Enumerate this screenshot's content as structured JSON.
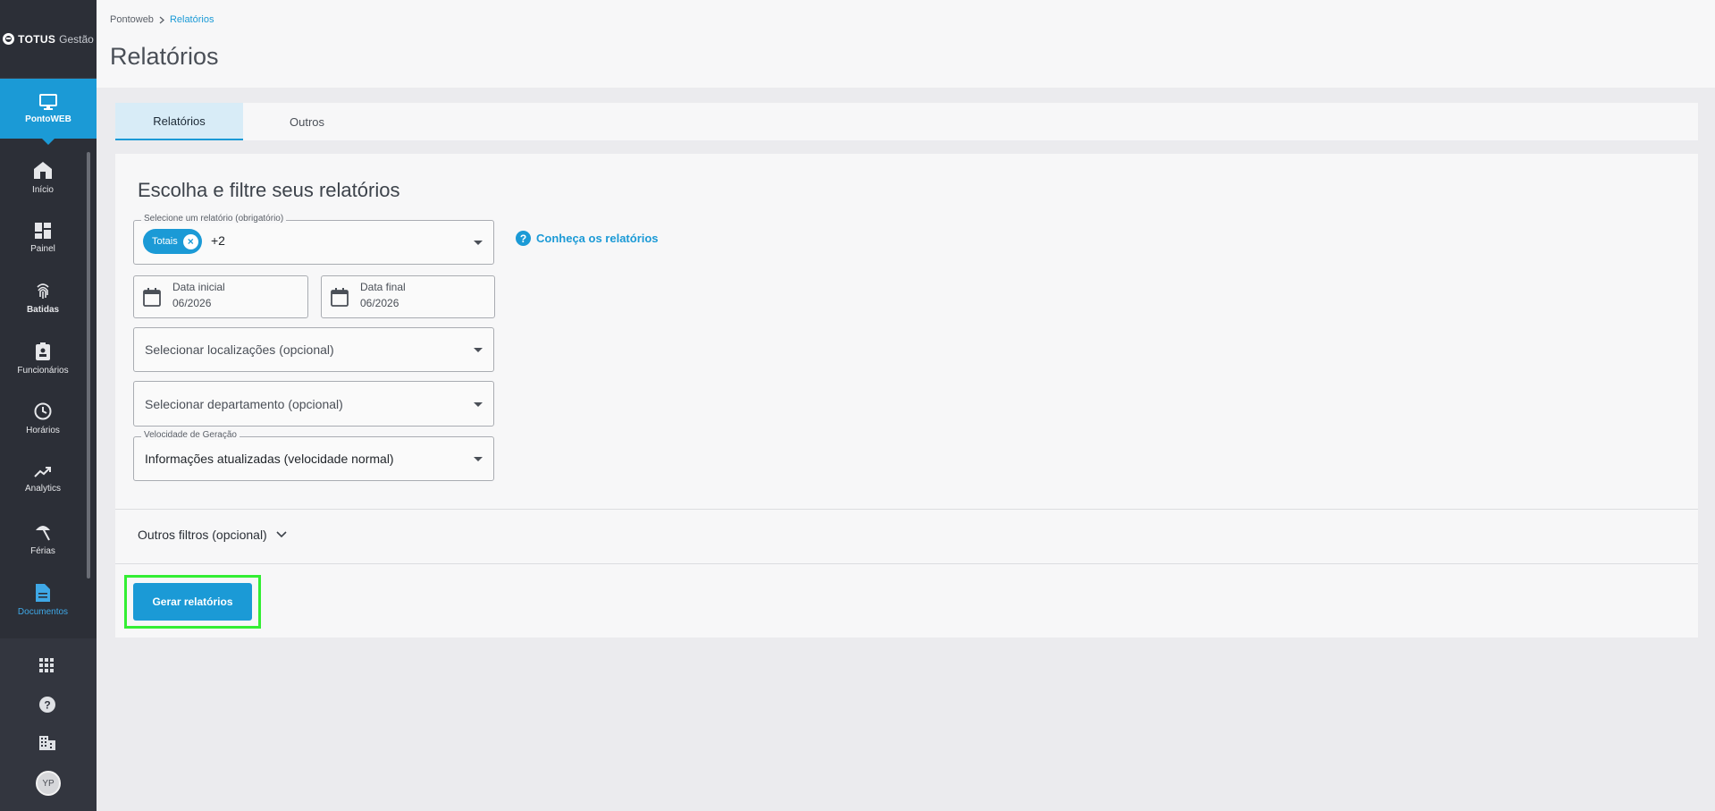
{
  "app": {
    "brand": "TOTUS",
    "brand_sub": "Gestão"
  },
  "sidebar": {
    "active": {
      "label": "PontoWEB",
      "icon": "monitor-icon"
    },
    "items": [
      {
        "label": "Início",
        "icon": "home-icon"
      },
      {
        "label": "Painel",
        "icon": "dashboard-icon"
      },
      {
        "label": "Batidas",
        "icon": "fingerprint-icon"
      },
      {
        "label": "Funcionários",
        "icon": "badge-icon"
      },
      {
        "label": "Horários",
        "icon": "clock-icon"
      },
      {
        "label": "Analytics",
        "icon": "trending-icon"
      },
      {
        "label": "Férias",
        "icon": "beach-icon"
      },
      {
        "label": "Documentos",
        "icon": "document-icon"
      }
    ],
    "bottom": {
      "apps_icon": "apps-grid-icon",
      "help_icon": "help-icon",
      "company_icon": "company-icon",
      "avatar_initials": "YP"
    }
  },
  "breadcrumb": {
    "root": "Pontoweb",
    "current": "Relatórios"
  },
  "page": {
    "title": "Relatórios"
  },
  "tabs": [
    {
      "label": "Relatórios",
      "active": true
    },
    {
      "label": "Outros",
      "active": false
    }
  ],
  "form": {
    "title": "Escolha e filtre seus relatórios",
    "report_select": {
      "legend": "Selecione um relatório (obrigatório)",
      "chip": "Totais",
      "more": "+2"
    },
    "help_link": "Conheça os relatórios",
    "date_start": {
      "label": "Data inicial",
      "value": "06/2026"
    },
    "date_end": {
      "label": "Data final",
      "value": "06/2026"
    },
    "locations": {
      "placeholder": "Selecionar localizações (opcional)"
    },
    "department": {
      "placeholder": "Selecionar departamento (opcional)"
    },
    "speed": {
      "legend": "Velocidade de Geração",
      "value": "Informações atualizadas (velocidade normal)"
    },
    "other_filters": "Outros filtros (opcional)",
    "submit": "Gerar relatórios"
  },
  "colors": {
    "accent": "#1b9ad6",
    "sidebar": "#2c2f37",
    "highlight": "#33ee33"
  }
}
